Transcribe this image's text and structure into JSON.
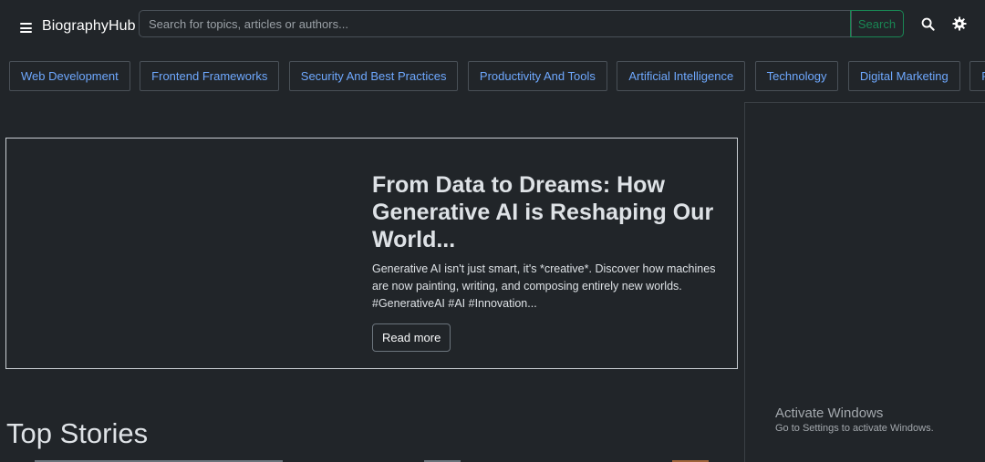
{
  "navbar": {
    "brand": "BiographyHub",
    "search_placeholder": "Search for topics, articles or authors...",
    "search_button": "Search"
  },
  "categories": [
    "Web Development",
    "Frontend Frameworks",
    "Security And Best Practices",
    "Productivity And Tools",
    "Artificial Intelligence",
    "Technology",
    "Digital Marketing",
    "Product"
  ],
  "hero": {
    "title": "From Data to Dreams: How Generative AI is Reshaping Our World...",
    "excerpt": "Generative AI isn't just smart, it's *creative*. Discover how machines are now painting, writing, and composing entirely new worlds. #GenerativeAI #AI #Innovation...",
    "read_more": "Read more"
  },
  "section": {
    "top_stories": "Top Stories"
  },
  "watermark": {
    "line1": "Activate Windows",
    "line2": "Go to Settings to activate Windows."
  },
  "colors": {
    "background": "#212529",
    "link": "#6ea8fe",
    "success": "#198754"
  }
}
